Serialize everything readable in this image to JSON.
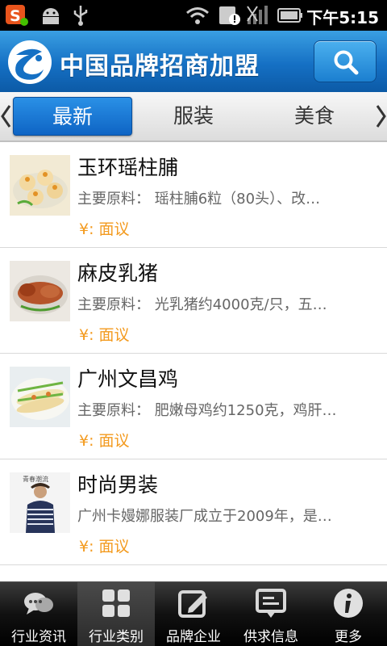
{
  "status_bar": {
    "time": "下午5:15"
  },
  "header": {
    "title": "中国品牌招商加盟"
  },
  "tabs": [
    {
      "label": "最新",
      "active": true
    },
    {
      "label": "服装",
      "active": false
    },
    {
      "label": "美食",
      "active": false
    }
  ],
  "items": [
    {
      "title": "玉环瑶柱脯",
      "desc": "主要原料： 瑶柱脯6粒（80头）、改…",
      "price": "¥: 面议"
    },
    {
      "title": "麻皮乳猪",
      "desc": "主要原料： 光乳猪约4000克/只，五…",
      "price": "¥: 面议"
    },
    {
      "title": "广州文昌鸡",
      "desc": "主要原料： 肥嫩母鸡约1250克，鸡肝…",
      "price": "¥: 面议"
    },
    {
      "title": "时尚男装",
      "desc": "广州卡嫚娜服装厂成立于2009年，是…",
      "price": "¥: 面议",
      "thumb_text": "青春潮流"
    }
  ],
  "bottom_nav": [
    {
      "label": "行业资讯",
      "icon": "chat-bubbles-icon"
    },
    {
      "label": "行业类别",
      "icon": "grid-icon",
      "active": true
    },
    {
      "label": "品牌企业",
      "icon": "edit-icon"
    },
    {
      "label": "供求信息",
      "icon": "message-icon"
    },
    {
      "label": "更多",
      "icon": "info-icon"
    }
  ],
  "colors": {
    "header_blue": "#1570c4",
    "price_orange": "#f39a1e",
    "tab_active": "#0e64c4"
  }
}
